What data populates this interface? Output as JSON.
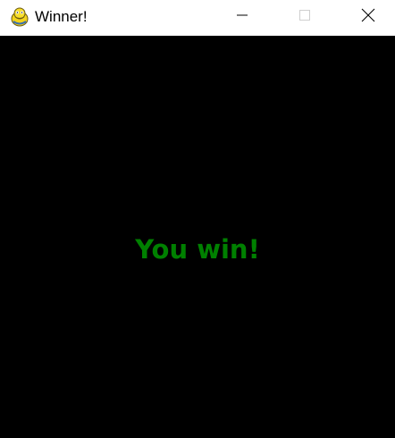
{
  "window": {
    "title": "Winner!",
    "app_icon": "pygame-snake-icon",
    "controls": {
      "minimize_icon": "minimize-icon",
      "maximize_icon": "maximize-icon",
      "close_icon": "close-icon"
    }
  },
  "content": {
    "message": "You win!",
    "message_color": "#008000",
    "background_color": "#000000"
  }
}
